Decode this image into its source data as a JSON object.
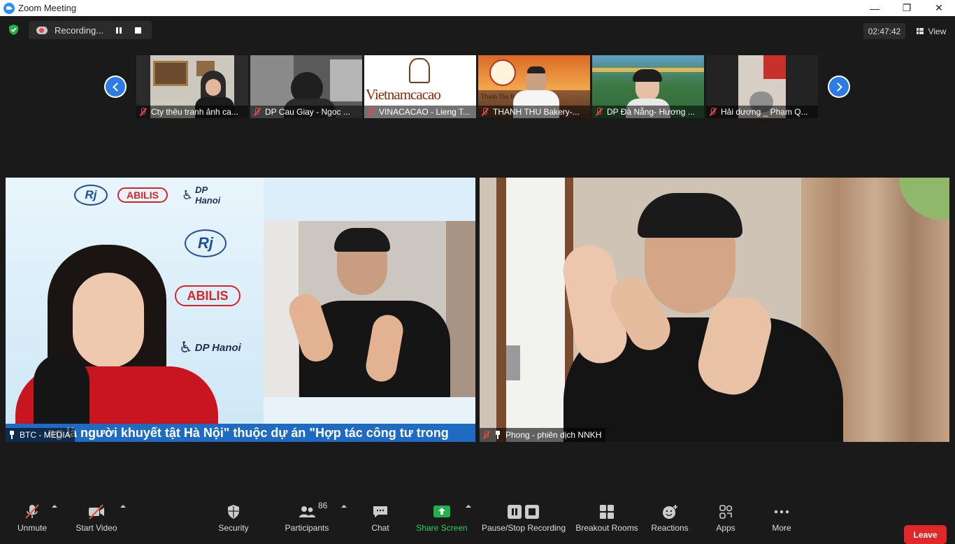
{
  "window": {
    "title": "Zoom Meeting",
    "controls": [
      "—",
      "❐",
      "✕"
    ]
  },
  "recording": {
    "label": "Recording..."
  },
  "timer": "02:47:42",
  "view": {
    "label": "View"
  },
  "thumbnails": [
    {
      "name": "Cty thêu tranh ảnh ca...",
      "muted": true
    },
    {
      "name": "DP Cau Giay - Ngoc ...",
      "muted": true
    },
    {
      "name": "VINACACAO - Lieng T...",
      "muted": true,
      "logo_text": "Vietnamcacao"
    },
    {
      "name": "THANH THU Bakery-...",
      "muted": true,
      "logo_text": "Thanh Thu Ba"
    },
    {
      "name": "DP Đà Nẵng- Hương ...",
      "muted": true
    },
    {
      "name": "Hải dương _ Phạm Q...",
      "muted": true
    }
  ],
  "main_videos": {
    "left": {
      "name": "BTC - MEDIA",
      "ticker": "ng là người khuyết tật Hà Nội\" thuộc dự án \"Hợp tác công tư trong",
      "logos": [
        "Rj",
        "ABILIS",
        "DP Hanoi",
        "Rj",
        "ABILIS",
        "DP Hanoi"
      ]
    },
    "right": {
      "name": "Phong - phiên dịch NNKH"
    }
  },
  "toolbar": {
    "unmute": "Unmute",
    "start_video": "Start Video",
    "security": "Security",
    "participants": "Participants",
    "participants_count": "86",
    "chat": "Chat",
    "share_screen": "Share Screen",
    "pause_stop_recording": "Pause/Stop Recording",
    "breakout_rooms": "Breakout Rooms",
    "reactions": "Reactions",
    "apps": "Apps",
    "more": "More",
    "leave": "Leave"
  },
  "colors": {
    "accent": "#2d8cff",
    "share": "#23b04a",
    "leave": "#e02828",
    "muted": "#e5484d"
  }
}
